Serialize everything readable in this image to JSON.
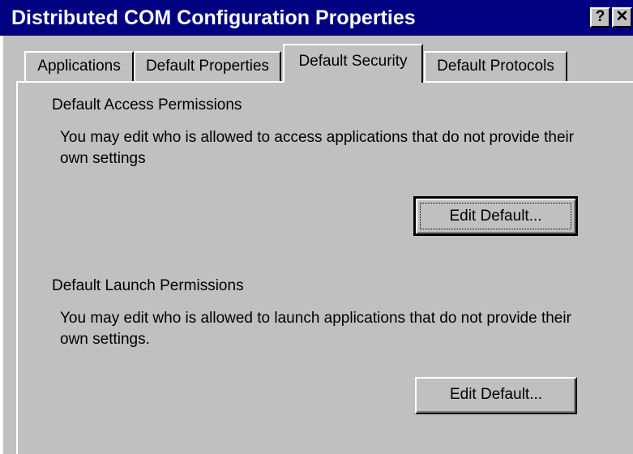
{
  "window": {
    "title": "Distributed COM Configuration Properties",
    "help_glyph": "?",
    "close_glyph": "✕",
    "titlebar_color": "#000080",
    "face_color": "#c0c0c0"
  },
  "tabs": [
    {
      "label": "Applications",
      "active": false
    },
    {
      "label": "Default Properties",
      "active": false
    },
    {
      "label": "Default Security",
      "active": true
    },
    {
      "label": "Default Protocols",
      "active": false
    }
  ],
  "access_permissions": {
    "legend": "Default Access Permissions",
    "description": "You may edit who is allowed to access applications that do not provide their own settings",
    "button_label": "Edit Default..."
  },
  "launch_permissions": {
    "legend": "Default Launch Permissions",
    "description": "You may edit who is allowed to launch applications that do not provide their own settings.",
    "button_label": "Edit Default..."
  }
}
